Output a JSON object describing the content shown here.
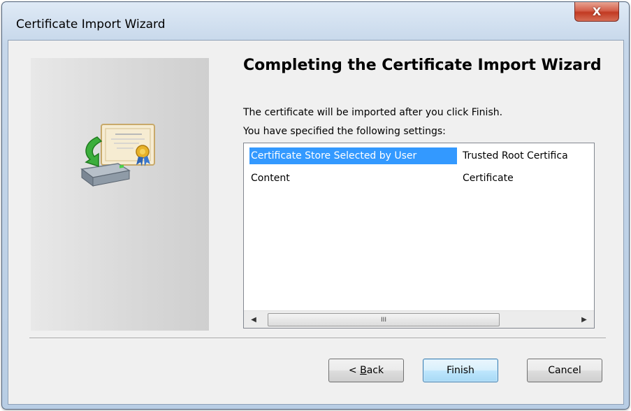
{
  "window": {
    "title": "Certificate Import Wizard",
    "close_glyph": "X"
  },
  "page": {
    "heading": "Completing the Certificate Import Wizard",
    "line1": "The certificate will be imported after you click Finish.",
    "line2": "You have specified the following settings:"
  },
  "settings_list": {
    "rows": [
      {
        "name": "Certificate Store Selected by User",
        "value": "Trusted Root Certifica",
        "selected": true
      },
      {
        "name": "Content",
        "value": "Certificate",
        "selected": false
      }
    ],
    "scroll_thumb_glyph": "III",
    "scroll_left_glyph": "◀",
    "scroll_right_glyph": "▶"
  },
  "buttons": {
    "back_prefix": "< ",
    "back_accel": "B",
    "back_rest": "ack",
    "finish": "Finish",
    "cancel": "Cancel"
  },
  "icons": {
    "wizard": "certificate-import-icon"
  },
  "colors": {
    "selection": "#3399ff",
    "close_button": "#c23a22"
  }
}
